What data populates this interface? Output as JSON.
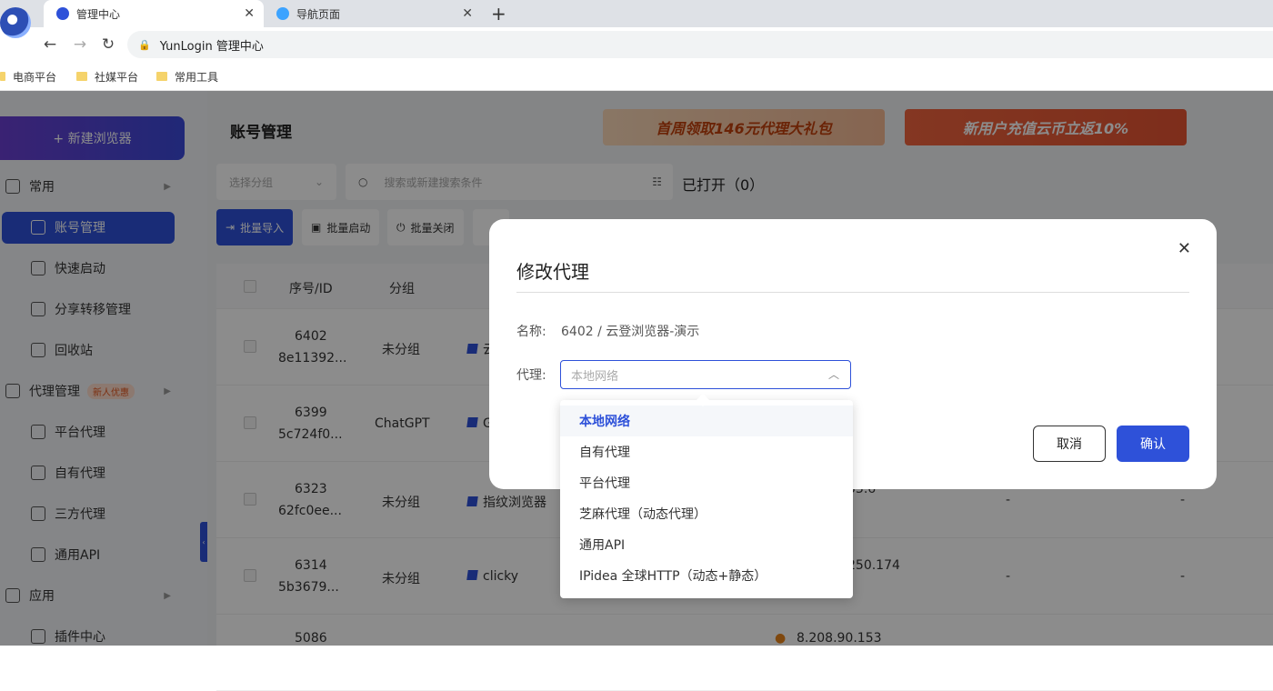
{
  "browser": {
    "tabs": [
      {
        "label": "管理中心",
        "active": true
      },
      {
        "label": "导航页面",
        "active": false
      }
    ],
    "new_tab": "+",
    "address": "YunLogin 管理中心",
    "bookmarks": [
      "电商平台",
      "社媒平台",
      "常用工具"
    ]
  },
  "sidebar": {
    "new_browser": "+ 新建浏览器",
    "items": [
      {
        "label": "常用",
        "type": "group"
      },
      {
        "label": "账号管理",
        "type": "child",
        "active": true
      },
      {
        "label": "快速启动",
        "type": "child"
      },
      {
        "label": "分享转移管理",
        "type": "child"
      },
      {
        "label": "回收站",
        "type": "child"
      },
      {
        "label": "代理管理",
        "type": "group",
        "badge": "新人优惠"
      },
      {
        "label": "平台代理",
        "type": "child"
      },
      {
        "label": "自有代理",
        "type": "child"
      },
      {
        "label": "三方代理",
        "type": "child"
      },
      {
        "label": "通用API",
        "type": "child"
      },
      {
        "label": "应用",
        "type": "group"
      },
      {
        "label": "插件中心",
        "type": "child"
      }
    ]
  },
  "main": {
    "title": "账号管理",
    "banners": [
      "首周领取146元代理大礼包",
      "新用户充值云币立返10%"
    ],
    "group_select_placeholder": "选择分组",
    "search_placeholder": "搜索或新建搜索条件",
    "opened": "已打开（0）",
    "toolbar": [
      "批量导入",
      "批量启动",
      "批量关闭"
    ],
    "table": {
      "headers": [
        "序号/ID",
        "分组"
      ],
      "rows": [
        {
          "seq": "6402",
          "id": "8e11392...",
          "group": "未分组",
          "name": "云",
          "ip": ""
        },
        {
          "seq": "6399",
          "id": "5c724f0...",
          "group": "ChatGPT",
          "name": "G",
          "ip": ""
        },
        {
          "seq": "6323",
          "id": "62fc0ee...",
          "group": "未分组",
          "name": "指纹浏览器",
          "ip": "33.6",
          "c1": "-",
          "c2": "-"
        },
        {
          "seq": "6314",
          "id": "5b3679...",
          "group": "未分组",
          "name": "clicky",
          "ip": "250.174",
          "c1": "-",
          "c2": "-"
        },
        {
          "seq": "5086",
          "id": "",
          "group": "",
          "name": "",
          "ip": "8.208.90.153"
        }
      ]
    }
  },
  "modal": {
    "title": "修改代理",
    "name_label": "名称:",
    "name_value": "6402 / 云登浏览器-演示",
    "proxy_label": "代理:",
    "proxy_value": "本地网络",
    "cancel": "取消",
    "confirm": "确认"
  },
  "dropdown": {
    "options": [
      "本地网络",
      "自有代理",
      "平台代理",
      "芝麻代理（动态代理）",
      "通用API",
      "IPidea 全球HTTP（动态+静态）"
    ],
    "selected_index": 0
  },
  "colors": {
    "primary": "#2e51d9",
    "badge": "#e2561e"
  }
}
